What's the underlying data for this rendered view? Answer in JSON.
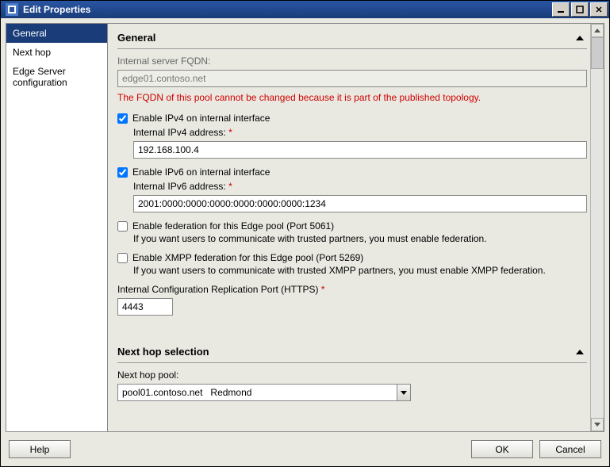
{
  "window": {
    "title": "Edit Properties"
  },
  "sidebar": {
    "items": [
      {
        "label": "General",
        "selected": true
      },
      {
        "label": "Next hop",
        "selected": false
      },
      {
        "label": "Edge Server configuration",
        "selected": false
      }
    ]
  },
  "sections": {
    "general": {
      "title": "General",
      "fqdn_label": "Internal server FQDN:",
      "fqdn_value": "edge01.contoso.net",
      "fqdn_warning": "The FQDN of this pool cannot be changed because it is part of the published topology.",
      "ipv4_enable_label": "Enable IPv4 on internal interface",
      "ipv4_enable_checked": true,
      "ipv4_addr_label": "Internal IPv4 address:",
      "ipv4_addr_value": "192.168.100.4",
      "ipv6_enable_label": "Enable IPv6 on internal interface",
      "ipv6_enable_checked": true,
      "ipv6_addr_label": "Internal IPv6 address:",
      "ipv6_addr_value": "2001:0000:0000:0000:0000:0000:0000:1234",
      "federation_enable_label": "Enable federation for this Edge pool (Port 5061)",
      "federation_enable_checked": false,
      "federation_hint": "If you want users to communicate with trusted partners, you must enable federation.",
      "xmpp_enable_label": "Enable XMPP federation for this Edge pool (Port 5269)",
      "xmpp_enable_checked": false,
      "xmpp_hint": "If you want users to communicate with trusted XMPP partners, you must enable XMPP federation.",
      "repl_port_label": "Internal Configuration Replication Port (HTTPS)",
      "repl_port_value": "4443"
    },
    "nexthop": {
      "title": "Next hop selection",
      "pool_label": "Next hop pool:",
      "pool_value": "pool01.contoso.net   Redmond"
    }
  },
  "footer": {
    "help": "Help",
    "ok": "OK",
    "cancel": "Cancel"
  },
  "required_mark": " *"
}
